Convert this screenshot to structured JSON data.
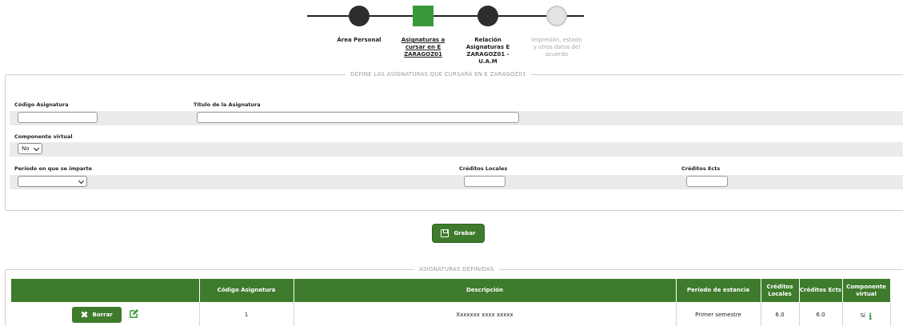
{
  "stepper": {
    "steps": [
      {
        "label_lines": [
          "Área Personal"
        ],
        "state": "completed"
      },
      {
        "label_lines": [
          "Asignaturas a",
          "cursar en E",
          "ZARAGOZ01"
        ],
        "state": "active"
      },
      {
        "label_lines": [
          "Relación",
          "Asignaturas E",
          "ZARAGOZ01 -",
          "U.A.M"
        ],
        "state": "completed"
      },
      {
        "label_lines": [
          "Impresión, estado",
          "y otros datos del",
          "acuerdo"
        ],
        "state": "pending"
      }
    ]
  },
  "define": {
    "legend": "DEFINE LAS ASIGNATURAS QUE CURSARÁ EN E ZARAGOZ01",
    "codigo_label": "Código Asignatura",
    "codigo_value": "",
    "titulo_label": "Título de la Asignatura",
    "titulo_value": "",
    "componente_label": "Componente virtual",
    "componente_value": "No",
    "periodo_label": "Período en que se imparte",
    "periodo_value": "",
    "creditos_locales_label": "Créditos Locales",
    "creditos_locales_value": "",
    "creditos_ects_label": "Créditos Ects",
    "creditos_ects_value": ""
  },
  "save_button": {
    "label": "Grabar"
  },
  "defined": {
    "legend": "ASIGNATURAS DEFINIDAS",
    "headers": {
      "codigo": "Código Asignatura",
      "descripcion": "Descripción",
      "periodo": "Período de estancia",
      "creditos_locales": "Créditos Locales",
      "creditos_ects": "Créditos Ects",
      "componente": "Componente virtual"
    },
    "rows": [
      {
        "delete_label": "Borrar",
        "codigo": "1",
        "descripcion": "Xxxxxxx xxxx xxxxx",
        "periodo": "Primer semestre",
        "creditos_locales": "6.0",
        "creditos_ects": "6.0",
        "componente": "Sí"
      }
    ]
  },
  "colors": {
    "accent_green": "#3e7b2c",
    "step_active": "#3a9a3a",
    "step_done": "#2d2d2d",
    "step_pending": "#e4e4e4"
  },
  "icons": [
    "save-icon",
    "close-icon",
    "edit-icon",
    "info-icon",
    "chevron-down-icon"
  ]
}
